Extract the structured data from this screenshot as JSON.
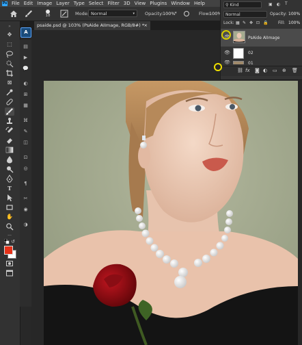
{
  "menu": [
    "File",
    "Edit",
    "Image",
    "Layer",
    "Type",
    "Select",
    "Filter",
    "3D",
    "View",
    "Plugins",
    "Window",
    "Help"
  ],
  "options": {
    "brush_size": "18",
    "mode_label": "Mode:",
    "mode_value": "Normal",
    "opacity_label": "Opacity:",
    "opacity_value": "100%",
    "flow_label": "Flow:",
    "flow_value": "100%"
  },
  "document": {
    "tab_title": "psaide.psd @ 103% (PsAide AIImage, RGB/8#) *",
    "close_symbol": "×"
  },
  "layers_panel": {
    "filter_label": "Kind",
    "blend_mode": "Normal",
    "opacity_label": "Opacity:",
    "opacity_value": "100%",
    "lock_label": "Lock:",
    "fill_label": "Fill:",
    "fill_value": "100%",
    "layers": [
      {
        "name": "PsAide AIImage"
      },
      {
        "name": "02"
      },
      {
        "name": "01"
      }
    ]
  },
  "colors": {
    "foreground": "#e53219",
    "background": "#ffffff",
    "photo_backdrop": "#a3aa8f"
  },
  "icons": [
    "home-icon",
    "brush-icon",
    "move-icon",
    "marquee-icon",
    "lasso-icon",
    "crop-icon",
    "eyedropper-icon",
    "healing-icon",
    "brush-tool-icon",
    "stamp-icon",
    "eraser-icon",
    "gradient-icon",
    "blur-icon",
    "dodge-icon",
    "pen-icon",
    "type-icon",
    "path-select-icon",
    "rectangle-icon",
    "hand-icon",
    "zoom-icon",
    "eye-icon",
    "link-icon",
    "fx-icon",
    "trash-icon"
  ]
}
